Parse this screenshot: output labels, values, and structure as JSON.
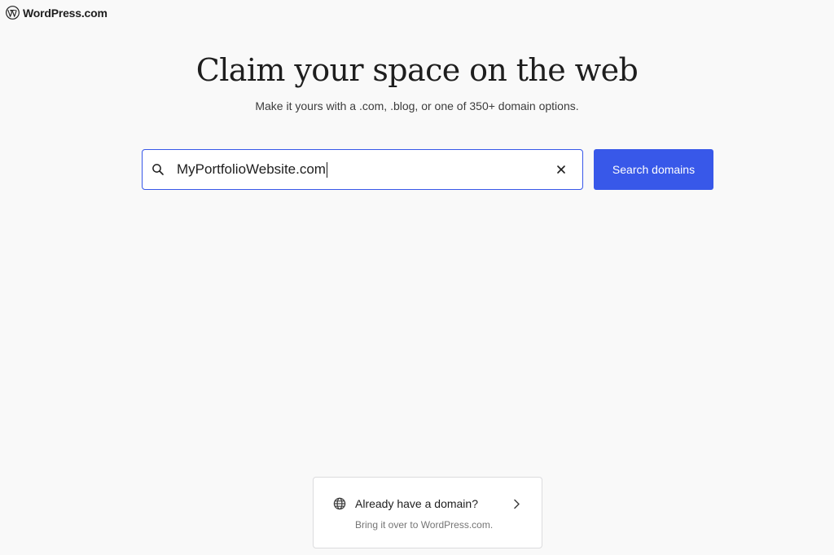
{
  "brand": {
    "name": "WordPress.com",
    "logo_icon": "wordpress-logo-icon"
  },
  "hero": {
    "title": "Claim your space on the web",
    "subtitle": "Make it yours with a .com, .blog, or one of 350+ domain options."
  },
  "search": {
    "value": "MyPortfolioWebsite.com",
    "search_icon": "search-icon",
    "clear_icon": "close-icon",
    "button_label": "Search domains"
  },
  "transfer": {
    "title": "Already have a domain?",
    "subtitle": "Bring it over to WordPress.com.",
    "icon": "globe-icon",
    "arrow_icon": "chevron-right-icon"
  },
  "colors": {
    "accent": "#3858e9",
    "background": "#f9f9f9",
    "text": "#1e1e1e",
    "muted": "#757575"
  }
}
